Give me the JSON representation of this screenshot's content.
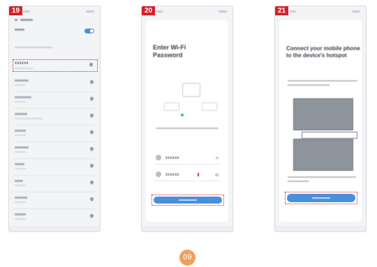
{
  "steps": [
    {
      "number": "19",
      "network_name": "xxxxxx"
    },
    {
      "number": "20",
      "title": "Enter Wi-Fi Password",
      "ssid_value": "xxxxxx",
      "password_value": "xxxxxx"
    },
    {
      "number": "21",
      "title": "Connect your mobile phone to the device's hotspot"
    }
  ],
  "page_number": "09",
  "colors": {
    "highlight_red": "#d1232a",
    "button_blue": "#4a8fdc",
    "page_badge_orange": "#f0a05c"
  }
}
